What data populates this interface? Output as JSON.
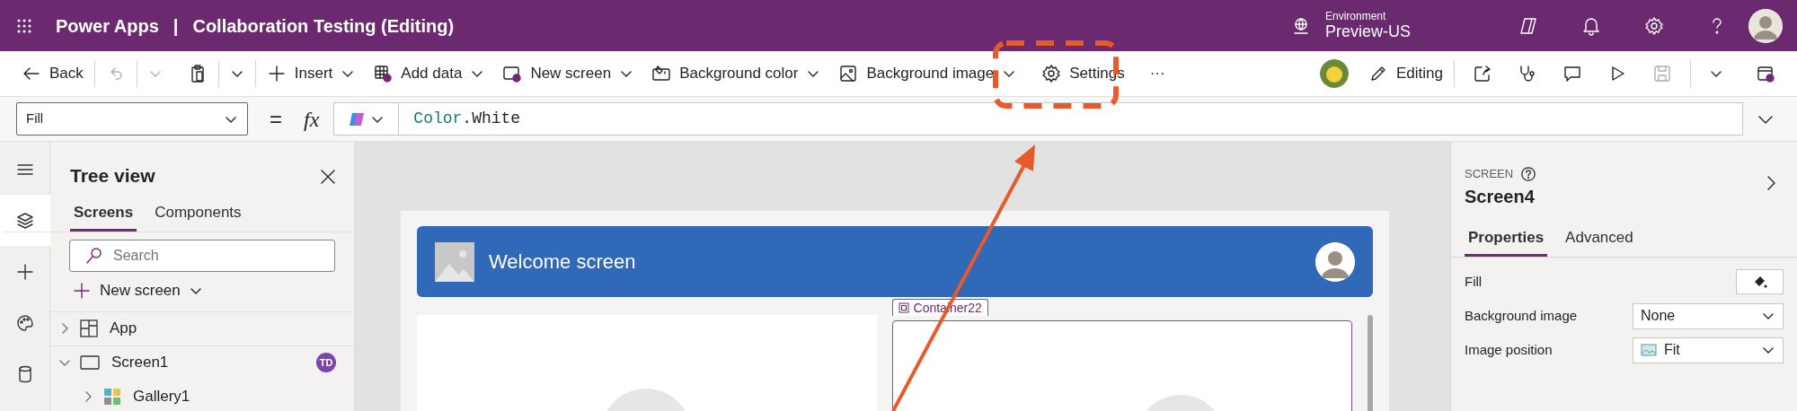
{
  "app_bar": {
    "product": "Power Apps",
    "separator": "|",
    "app_title": "Collaboration Testing (Editing)",
    "environment_label": "Environment",
    "environment": "Preview-US"
  },
  "toolbar": {
    "back": "Back",
    "undo_disabled": true,
    "insert": "Insert",
    "add_data": "Add data",
    "new_screen": "New screen",
    "background_color": "Background color",
    "background_image": "Background image",
    "settings": "Settings",
    "more": "···",
    "editing": "Editing",
    "save_disabled": true
  },
  "formula_bar": {
    "property": "Fill",
    "equals": "=",
    "fx": "fx",
    "tokens": [
      {
        "text": "Color",
        "kind": "enum"
      },
      {
        "text": ".White",
        "kind": "member"
      }
    ]
  },
  "rail": {
    "items": [
      {
        "selected": false
      },
      {
        "selected": true
      },
      {
        "selected": false
      },
      {
        "selected": false
      },
      {
        "selected": false
      }
    ]
  },
  "tree_view": {
    "title": "Tree view",
    "tabs": [
      {
        "label": "Screens",
        "selected": true
      },
      {
        "label": "Components",
        "selected": false
      }
    ],
    "search": {
      "placeholder": "Search"
    },
    "new_screen": "New screen",
    "items": [
      {
        "label": "App",
        "kind": "app",
        "expanded": false
      },
      {
        "label": "Screen1",
        "kind": "screen",
        "expanded": true,
        "badge": "TD",
        "children": [
          {
            "label": "Gallery1",
            "kind": "gallery",
            "expanded": false
          }
        ]
      }
    ]
  },
  "canvas": {
    "header": "Welcome screen",
    "container_label": "Container22"
  },
  "properties": {
    "type": "SCREEN",
    "name": "Screen4",
    "tabs": [
      {
        "label": "Properties",
        "selected": true
      },
      {
        "label": "Advanced",
        "selected": false
      }
    ],
    "fields": [
      {
        "label": "Fill",
        "kind": "color"
      },
      {
        "label": "Background image",
        "kind": "select",
        "value": "None"
      },
      {
        "label": "Image position",
        "kind": "image-select",
        "value": "Fit"
      }
    ]
  }
}
